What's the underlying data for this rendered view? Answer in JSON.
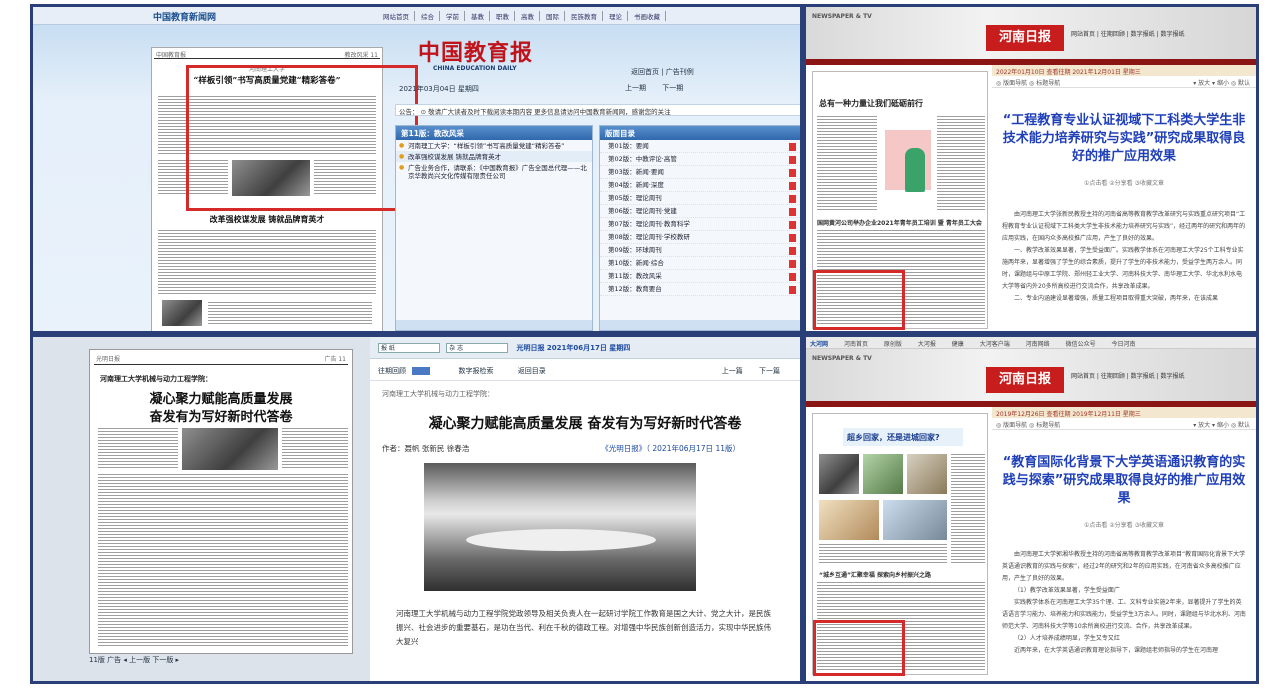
{
  "panel1": {
    "site_logo": "中国教育新闻网",
    "nav": [
      "网站首页",
      "综合",
      "学前",
      "基教",
      "职教",
      "高教",
      "国际",
      "民族教育",
      "理论",
      "书画收藏"
    ],
    "masthead": "中国教育报",
    "masthead_sub": "CHINA EDUCATION DAILY",
    "date": "2021年03月04日 星期四",
    "top_links": "返回首页 | 广告刊例",
    "prev": "上一期",
    "next": "下一期",
    "notice": "公告：  ⊙ 敬请广大读者及时下载阅读本期内容  更多信息请访问中国教育新闻网，感谢您的关注",
    "paper_header_left": "中国教育报",
    "paper_header_right": "教改风采 11",
    "paper_kicker": "河南理工大学",
    "paper_headline": "“样板引领”书写高质量党建“精彩答卷”",
    "paper_second_headline": "改革强校谋发展  铸就品牌育英才",
    "section_title": "第11版：教改风采",
    "articles": [
      "河南理工大学：“样板引领”书写高质量党建“精彩答卷”",
      "改革强校谋发展 铸就品牌育英才",
      "广告业务合作，请联系：《中国教育报》广告全国总代理——北京华教尚兴文化传媒有限责任公司"
    ],
    "layout_title": "版面目录",
    "layouts": [
      "第01版：要闻",
      "第02版：中教评论·高管",
      "第03版：新闻·要闻",
      "第04版：新闻·深度",
      "第05版：理论周刊",
      "第06版：理论周刊·党建",
      "第07版：理论周刊·教育科学",
      "第08版：理论周刊·学校教研",
      "第09版：环球周刊",
      "第10版：新闻·综合",
      "第11版：教改风采",
      "第12版：教育要台"
    ]
  },
  "panel2": {
    "banner_label": "NEWSPAPER & TV",
    "logo": "河南日报",
    "links": "网站首页 | 往期回顾 | 数字报纸 | 数字报纸",
    "date_bar": "2022年01月10日  查看往期 2021年12月01日  星期三",
    "tools_left": "◎ 版面导航  ◎ 标题导航",
    "tools_right": "▾ 放大  ▾ 缩小  ◎ 默认",
    "page_headline": "总有一种力量让我们砥砺前行",
    "page_caption": "国网黄河公司举办企业2021年青年员工培训 暨 青年员工大会",
    "title": "“工程教育专业认证视域下工科类大学生非技术能力培养研究与实践”研究成果取得良好的推广应用效果",
    "meta": "①点击看   ②分享看   ③收藏文章",
    "paragraphs": [
      "由河南理工大学张新民教授主持的河南省高等教育教学改革研究与实践重点研究项目“工程教育专业认证视域下工科类大学生非技术能力培养研究与实践”，经过两年的研究和两年的应用实践，在国内众多高校推广应用，产生了良好的效果。",
      "一、教学改革效果显著，学生受益面广。实践教学体系在河南理工大学25个工科专业实施两年来，显著增强了学生的综合素质，提升了学生的非技术能力，受益学生两万余人。同时，课题组与中原工学院、郑州轻工业大学、河南科技大学、南华理工大学、华北水利水电大学等省内外20多所高校进行交流合作，共享改革成果。",
      "二、专业内涵建设显著增强，质量工程项目取得重大突破，两年来，在该成果"
    ]
  },
  "panel3": {
    "paper_header_left": "光明日报",
    "paper_header_right": "广告 11",
    "paper_kicker": "河南理工大学机械与动力工程学院：",
    "paper_headline_1": "凝心聚力赋能高质量发展",
    "paper_headline_2": "奋发有为写好新时代答卷",
    "left_footer": "11版 广告  ◂ 上一版  下一版 ▸",
    "select_1": "报 纸",
    "select_2": "杂 志",
    "date": "光明日报   2021年06月17日   星期四",
    "archive": "往期回顾",
    "search": "数字报检索",
    "back": "返回目录",
    "prev": "上一篇",
    "next": "下一篇",
    "kicker": "河南理工大学机械与动力工程学院：",
    "headline": "凝心聚力赋能高质量发展 奋发有为写好新时代答卷",
    "byline": "作者：聂帆  张新民  徐春浩",
    "source": "《光明日报》（ 2021年06月17日   11版）",
    "body": "河南理工大学机械与动力工程学院党政领导及相关负责人在一起研讨学院工作教育是国之大计、党之大计，是民族振兴、社会进步的重要基石，是功在当代、利在千秋的德政工程。对增强中华民族创新创造活力，实现中华民族伟大复兴"
  },
  "panel4": {
    "site_tag": "大河网",
    "nav": [
      "河南首页",
      "原创版",
      "大河报",
      "健康",
      "大河客户端",
      "河南网络",
      "微信公众号",
      "今日河南"
    ],
    "banner_label": "NEWSPAPER & TV",
    "logo": "河南日报",
    "links": "网站首页 | 往期回顾 | 数字报纸 | 数字报纸",
    "date_bar": "2019年12月26日  查看往期 2019年12月11日  星期三",
    "tools_left": "◎ 版面导航  ◎ 标题导航",
    "tools_right": "▾ 放大  ▾ 缩小  ◎ 默认",
    "page_headline": "超乡回家，还是进城回家?",
    "page_caption": "“城乡互通”汇聚幸福 探索向乡村振兴之路",
    "title": "“教育国际化背景下大学英语通识教育的实践与探索”研究成果取得良好的推广应用效果",
    "meta": "①点击看   ②分享看   ③收藏文章",
    "paragraphs": [
      "由河南理工大学郭湘华教授主持的河南省高等教育教学改革项目“教育国际化背景下大学英语通识教育的实践与探索”，经过2年的研究和2年的应用实践，在河南省众多高校推广应用，产生了良好的效果。",
      "（1）教学改革效果显著，学生受益面广",
      "实践教学体系在河南理工大学35个理、工、文科专业实施2年来，显著提升了学生的英语语言学习能力、培养能力和实践能力，受益学生3万余人。同时，课题组与华北水利、河南师范大学、河南科技大学等10余所高校进行交流、合作，共享改革成果。",
      "（2）人才培养成绩明显，学生又专又红",
      "近两年来，在大学英语通识教育理论指导下，课题组老师指导的学生在河南理"
    ]
  }
}
